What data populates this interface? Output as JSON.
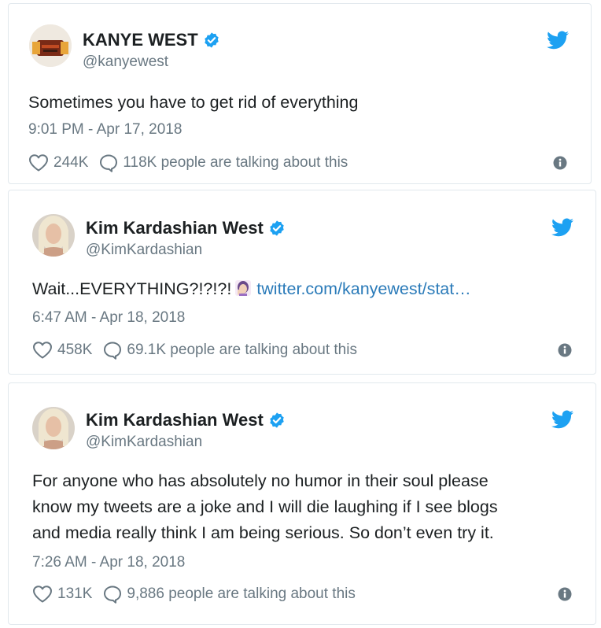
{
  "tweets": [
    {
      "name": "KANYE WEST",
      "handle": "@kanyewest",
      "text": "Sometimes you have to get rid of everything",
      "time": "9:01 PM - Apr 17, 2018",
      "likes": "244K",
      "talking": "118K people are talking about this"
    },
    {
      "name": "Kim Kardashian West",
      "handle": "@KimKardashian",
      "text": "Wait...EVERYTHING?!?!?!",
      "link": "twitter.com/kanyewest/stat…",
      "time": "6:47 AM - Apr 18, 2018",
      "likes": "458K",
      "talking": "69.1K people are talking about this"
    },
    {
      "name": "Kim Kardashian West",
      "handle": "@KimKardashian",
      "text_lines": [
        "For anyone who has absolutely no humor in their soul please",
        "know my tweets are a joke and I will die laughing if I see blogs",
        "and media really think I am being serious. So don’t even try it."
      ],
      "time": "7:26 AM - Apr 18, 2018",
      "likes": "131K",
      "talking": "9,886 people are talking about this"
    }
  ],
  "icons": {
    "verified": "verified-badge-icon",
    "bird": "twitter-bird-icon",
    "heart": "heart-icon",
    "reply": "reply-bubble-icon",
    "info": "info-icon",
    "emoji": "woman-facepalming-emoji"
  },
  "colors": {
    "verified": "#1da1f2",
    "link": "#2b7bb9",
    "muted": "#697882"
  }
}
